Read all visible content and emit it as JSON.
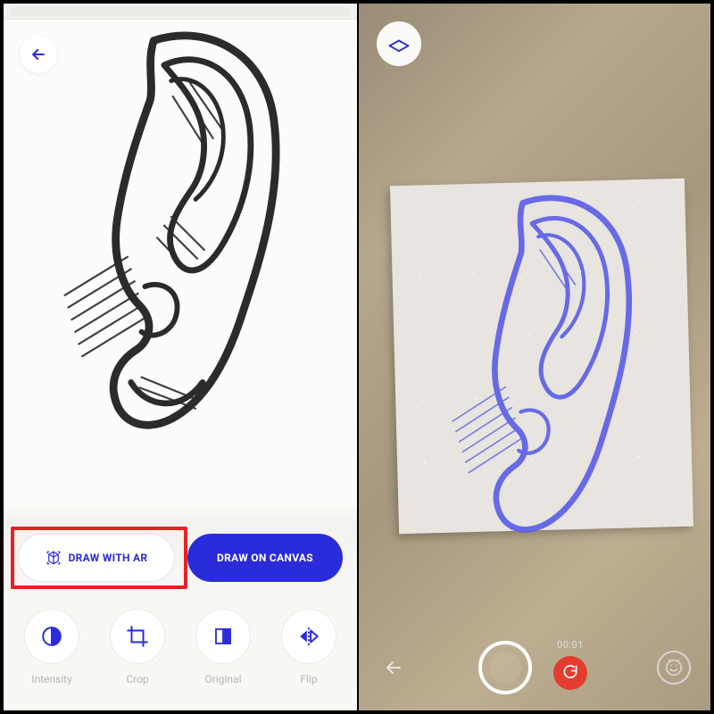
{
  "left": {
    "actions": {
      "draw_ar_label": "DRAW WITH AR",
      "draw_canvas_label": "DRAW ON CANVAS"
    },
    "tools": [
      {
        "name": "intensity",
        "label": "Intensity",
        "icon": "half-circle-icon"
      },
      {
        "name": "crop",
        "label": "Crop",
        "icon": "crop-icon"
      },
      {
        "name": "original",
        "label": "Original",
        "icon": "half-rect-icon"
      },
      {
        "name": "flip",
        "label": "Flip",
        "icon": "flip-icon"
      }
    ],
    "highlight_target": "draw-with-ar-button"
  },
  "right": {
    "timer": "00:01"
  },
  "colors": {
    "accent": "#2a2bd9",
    "record": "#e63b2f",
    "highlight": "#e92121"
  },
  "icons": {
    "back_arrow": "arrow-left-icon",
    "ar_cube": "ar-cube-icon",
    "surface": "surface-plane-icon",
    "record_reset": "record-arrow-icon",
    "face_filter": "face-filter-icon"
  },
  "sketch_subject": "ear"
}
